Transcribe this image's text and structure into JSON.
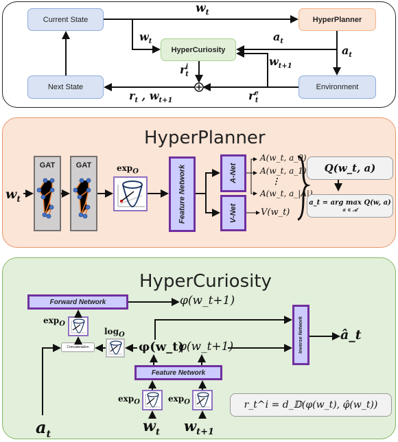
{
  "overview": {
    "nodes": {
      "current_state": "Current State",
      "hyperplanner": "HyperPlanner",
      "hypercuriosity": "HyperCuriosity",
      "next_state": "Next State",
      "environment": "Environment"
    },
    "edge_labels": {
      "w_t_top": "w_t",
      "w_t_side": "w_t",
      "a_t_left": "a_t",
      "a_t_right": "a_t",
      "w_t1": "w_t+1",
      "r_i": "r_t^i",
      "r_e": "r_t^e",
      "r_w": "r_t , w_t+1"
    },
    "sum_symbol": "⊕"
  },
  "hyperplanner": {
    "title": "HyperPlanner",
    "input": "w_t",
    "gat_labels": [
      "GAT",
      "GAT"
    ],
    "exp_label": "exp_O",
    "feature_network": "Feature Network",
    "a_net": "A-Net",
    "v_net": "V-Net",
    "a_outputs": [
      "A(w_t, a_0)",
      "A(w_t, a_1)",
      "⋮",
      "A(w_t, a_|A|)"
    ],
    "v_output": "V(w_t)",
    "q_value": "Q(w_t, a)",
    "argmax": "a_t = arg max Q(w, a)",
    "argmax_sub": "a ∈ 𝒜"
  },
  "hypercuriosity": {
    "title": "HyperCuriosity",
    "forward_network": "Forward Network",
    "forward_output": "φ(w_t+1)",
    "exp_label": "exp_O",
    "log_label": "log_O",
    "concatenation": "Concatenation",
    "phi_wt": "φ(w_t)",
    "phi_wt1": "φ(w_t+1)",
    "inverse_network": "Inverse Network",
    "inverse_output": "â_t",
    "feature_network": "Feature Network",
    "exp_left": "exp_O",
    "exp_right": "exp_O",
    "input_at": "a_t",
    "input_wt": "w_t",
    "input_wt1": "w_t+1",
    "reward_formula": "r_t^i = d_𝔻(φ(w_t), φ̂(w_t))"
  }
}
